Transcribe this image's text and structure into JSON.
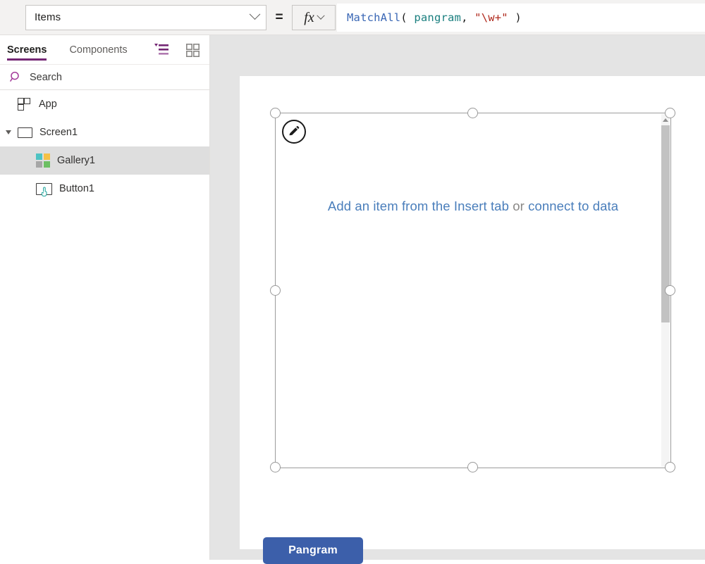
{
  "formula_bar": {
    "property_value": "Items",
    "equals": "=",
    "fx_label": "fx",
    "formula_tokens": [
      {
        "text": "MatchAll",
        "kind": "fn"
      },
      {
        "text": "( ",
        "kind": "punct"
      },
      {
        "text": "pangram",
        "kind": "ident"
      },
      {
        "text": ", ",
        "kind": "punct"
      },
      {
        "text": "\"\\w+\"",
        "kind": "string"
      },
      {
        "text": " )",
        "kind": "punct"
      }
    ],
    "formula_plain": "MatchAll( pangram, \"\\w+\" )"
  },
  "left_panel": {
    "tabs": [
      {
        "label": "Screens",
        "active": true
      },
      {
        "label": "Components",
        "active": false
      }
    ],
    "view_icons": [
      {
        "name": "tree-view-icon",
        "color": "#742774"
      },
      {
        "name": "thumbnail-view-icon",
        "color": "#8a8886"
      }
    ],
    "search": {
      "placeholder": "Search",
      "value": "",
      "icon": "search-icon",
      "icon_color": "#a33a9a"
    },
    "tree": [
      {
        "label": "App",
        "icon": "app-icon",
        "level": 0,
        "selected": false,
        "expandable": false
      },
      {
        "label": "Screen1",
        "icon": "screen-icon",
        "level": 1,
        "selected": false,
        "expandable": true,
        "expanded": true
      },
      {
        "label": "Gallery1",
        "icon": "gallery-icon",
        "level": 2,
        "selected": true,
        "expandable": false
      },
      {
        "label": "Button1",
        "icon": "button-icon",
        "level": 2,
        "selected": false,
        "expandable": false
      }
    ],
    "gallery_icon_colors": [
      "#4ec3c3",
      "#f5c146",
      "#a6a6a6",
      "#6cbf63"
    ]
  },
  "canvas": {
    "gallery": {
      "name": "Gallery1",
      "placeholder_link_1": "Add an item from the Insert tab",
      "placeholder_or": " or ",
      "placeholder_link_2": "connect to data",
      "edit_badge_icon": "pencil-icon",
      "scrollbar": {
        "up_arrow_icon": "chevron-up-icon"
      }
    },
    "button": {
      "name": "Button1",
      "text": "Pangram",
      "fill": "#3c5faa",
      "color": "#ffffff"
    }
  },
  "colors": {
    "accent_purple": "#742774",
    "canvas_bg": "#e4e4e4",
    "formula_bar_bg": "#f3f2f1",
    "selection_outline": "#9c9c9c",
    "link_blue": "#4a7ebb"
  }
}
